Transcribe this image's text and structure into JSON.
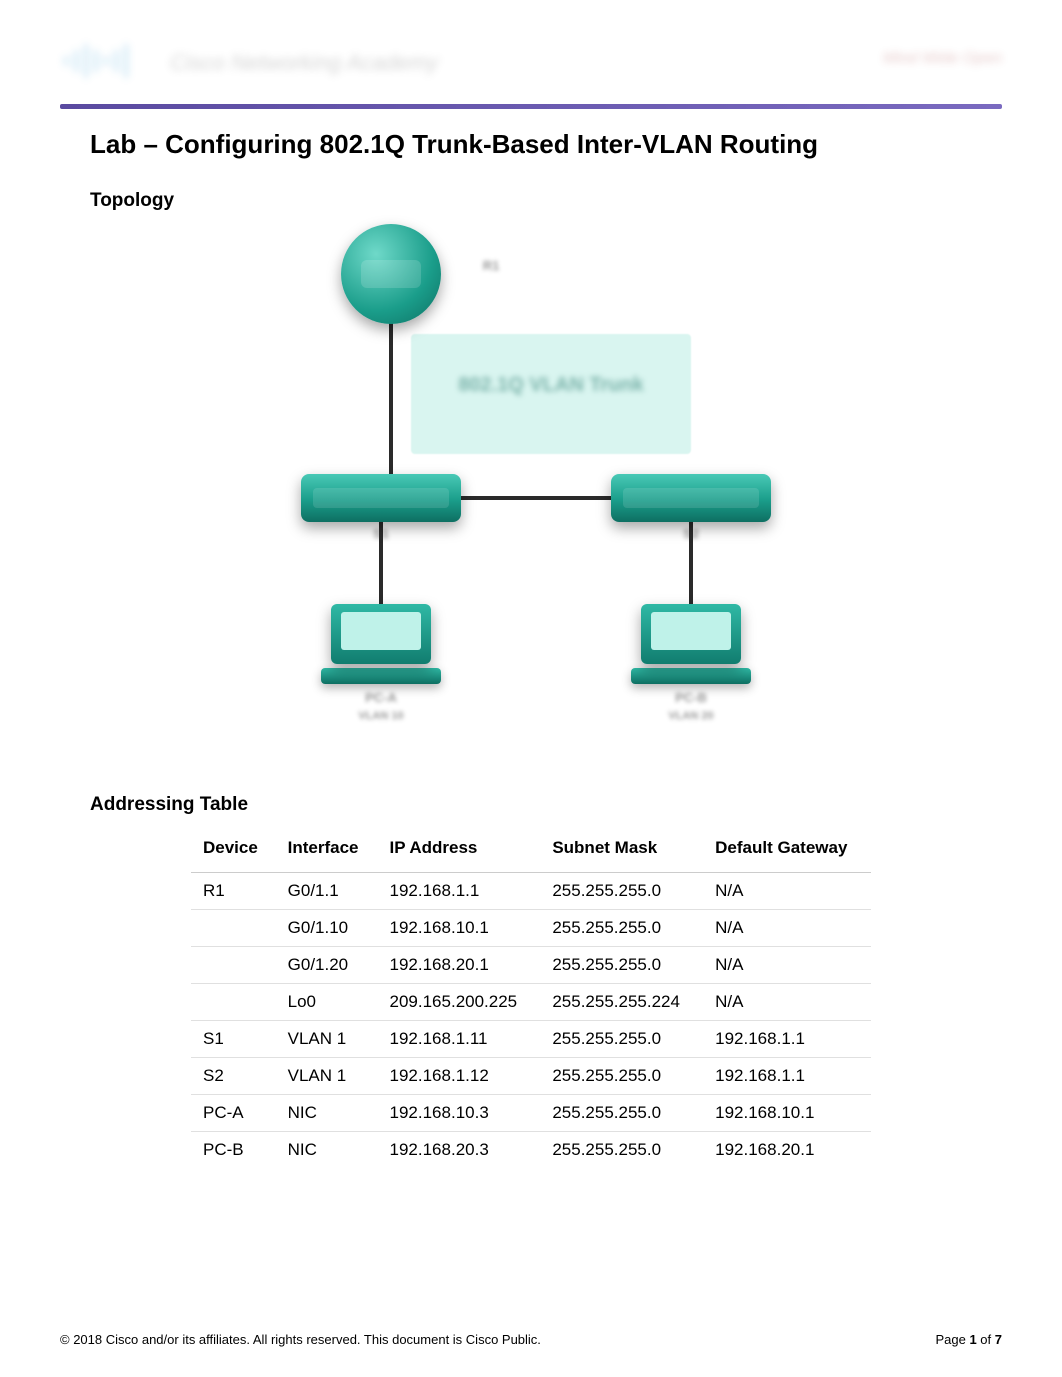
{
  "header": {
    "brand_blur": "cisco",
    "text_blur": "Cisco Networking Academy",
    "right_blur": "Mind Wide Open"
  },
  "title": "Lab – Configuring 802.1Q Trunk-Based Inter-VLAN Routing",
  "sections": {
    "topology": "Topology",
    "addressing": "Addressing Table"
  },
  "topology": {
    "trunk_label": "802.1Q VLAN Trunk",
    "router_label": "R1",
    "sw1_label": "S1",
    "sw2_label": "S2",
    "pc1_label": "PC-A",
    "pc2_label": "PC-B",
    "vlan10_label": "VLAN 10",
    "vlan20_label": "VLAN 20"
  },
  "addressing_table": {
    "headers": {
      "device": "Device",
      "interface": "Interface",
      "ip": "IP Address",
      "mask": "Subnet Mask",
      "gw": "Default Gateway"
    },
    "rows": [
      {
        "device": "R1",
        "interface": "G0/1.1",
        "ip": "192.168.1.1",
        "mask": "255.255.255.0",
        "gw": "N/A"
      },
      {
        "device": "",
        "interface": "G0/1.10",
        "ip": "192.168.10.1",
        "mask": "255.255.255.0",
        "gw": "N/A"
      },
      {
        "device": "",
        "interface": "G0/1.20",
        "ip": "192.168.20.1",
        "mask": "255.255.255.0",
        "gw": "N/A"
      },
      {
        "device": "",
        "interface": "Lo0",
        "ip": "209.165.200.225",
        "mask": "255.255.255.224",
        "gw": "N/A"
      },
      {
        "device": "S1",
        "interface": "VLAN 1",
        "ip": "192.168.1.11",
        "mask": "255.255.255.0",
        "gw": "192.168.1.1"
      },
      {
        "device": "S2",
        "interface": "VLAN 1",
        "ip": "192.168.1.12",
        "mask": "255.255.255.0",
        "gw": "192.168.1.1"
      },
      {
        "device": "PC-A",
        "interface": "NIC",
        "ip": "192.168.10.3",
        "mask": "255.255.255.0",
        "gw": "192.168.10.1"
      },
      {
        "device": "PC-B",
        "interface": "NIC",
        "ip": "192.168.20.3",
        "mask": "255.255.255.0",
        "gw": "192.168.20.1"
      }
    ]
  },
  "footer": {
    "copyright": "© 2018 Cisco and/or its affiliates. All rights reserved. This document is Cisco Public.",
    "page_prefix": "Page ",
    "page_current": "1",
    "page_sep": " of ",
    "page_total": "7"
  }
}
